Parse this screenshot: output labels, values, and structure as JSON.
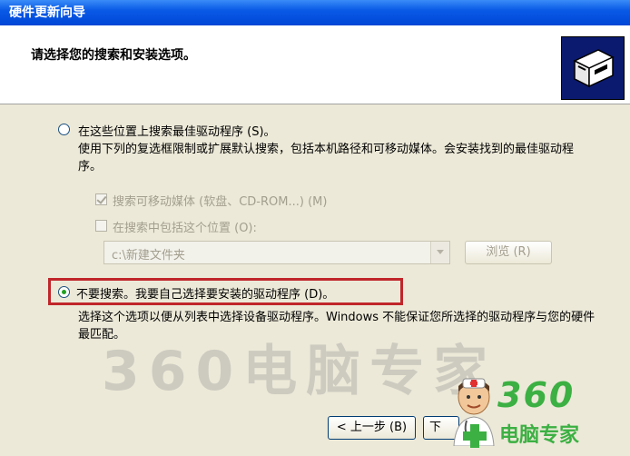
{
  "window": {
    "title": "硬件更新向导"
  },
  "header": {
    "title": "请选择您的搜索和安装选项。"
  },
  "options": {
    "search": {
      "label": "在这些位置上搜索最佳驱动程序 (S)。",
      "description": "使用下列的复选框限制或扩展默认搜索，包括本机路径和可移动媒体。会安装找到的最佳驱动程序。",
      "selected": false,
      "removable_media": {
        "label": "搜索可移动媒体 (软盘、CD-ROM...) (M)",
        "checked": true,
        "enabled": false
      },
      "include_location": {
        "label": "在搜索中包括这个位置 (O):",
        "checked": false,
        "enabled": false
      },
      "location_value": "c:\\新建文件夹",
      "browse_label": "浏览 (R)"
    },
    "no_search": {
      "label": "不要搜索。我要自己选择要安装的驱动程序 (D)。",
      "description": "选择这个选项以便从列表中选择设备驱动程序。Windows 不能保证您所选择的驱动程序与您的硬件最匹配。",
      "selected": true
    }
  },
  "footer": {
    "back_label": "< 上一步 (B)",
    "next_label": "下"
  },
  "watermark": {
    "text": "360电脑专家",
    "logo_number": "360",
    "logo_text": "电脑专家"
  },
  "colors": {
    "titlebar": "#0A5AE6",
    "highlight": "#C0262B",
    "radio_dot": "#21A121",
    "logo_green": "#3CB043"
  }
}
